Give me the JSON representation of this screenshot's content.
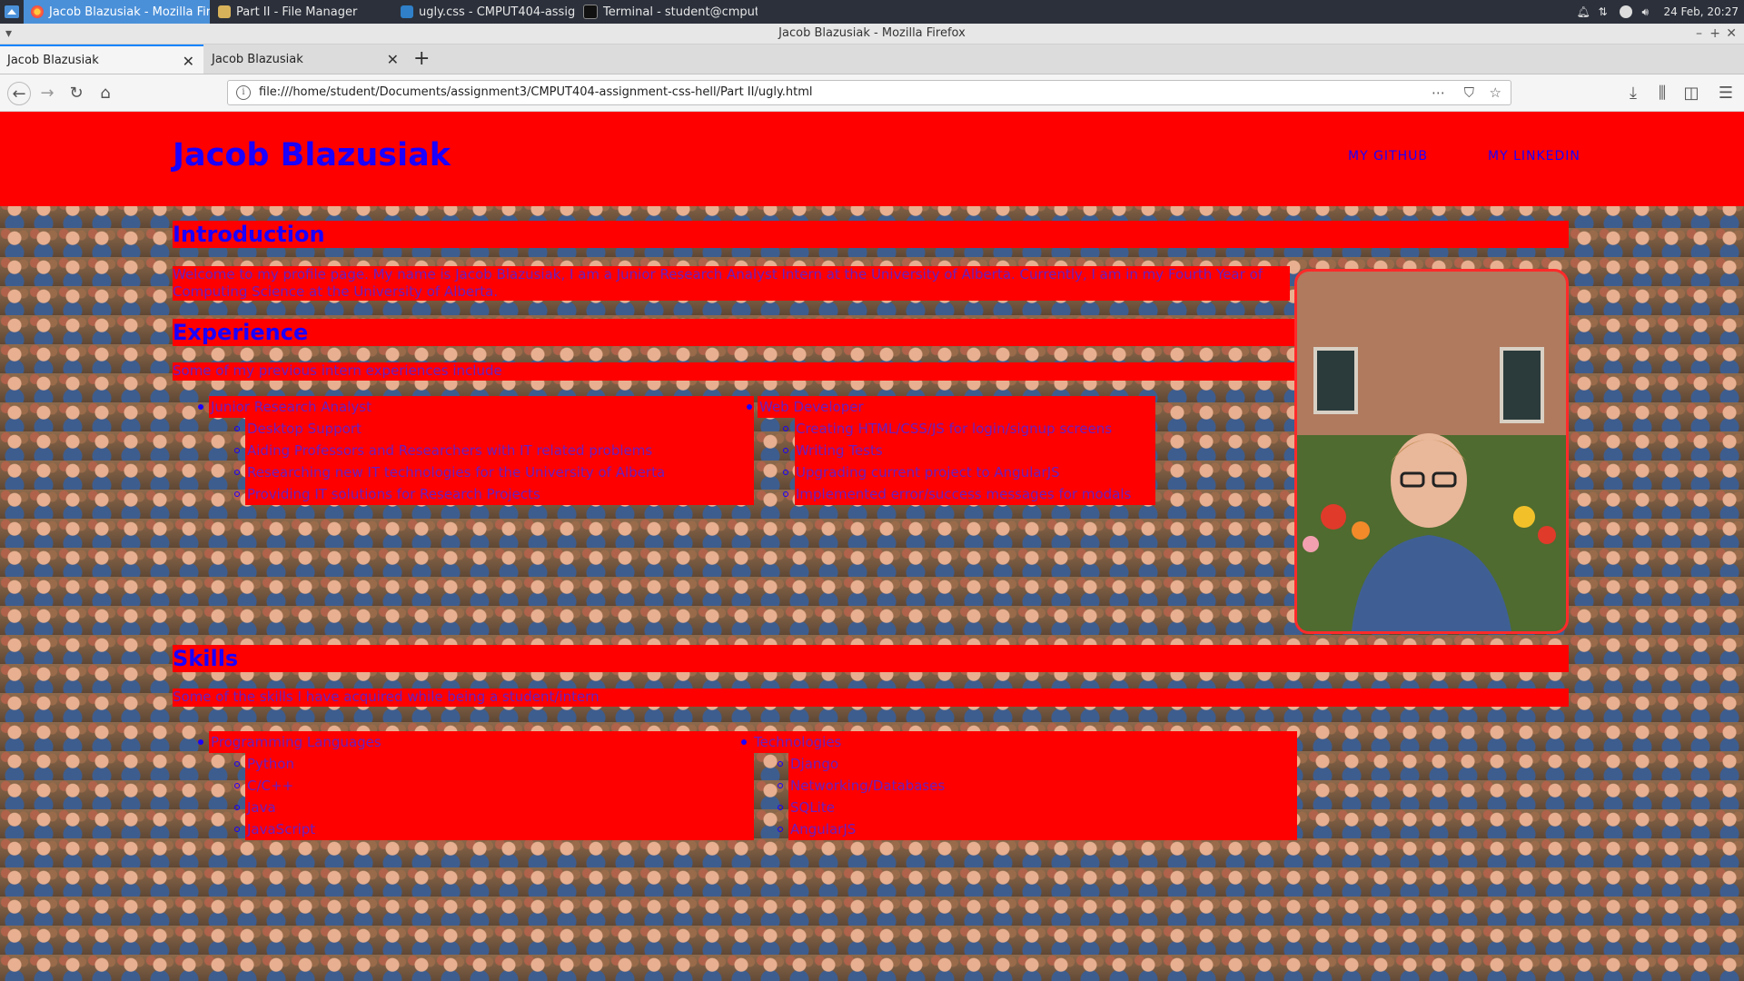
{
  "taskbar": {
    "tasks": [
      {
        "label": "Jacob Blazusiak - Mozilla Fire...",
        "active": true
      },
      {
        "label": "Part II - File Manager",
        "active": false
      },
      {
        "label": "ugly.css - CMPUT404-assign...",
        "active": false
      },
      {
        "label": "Terminal - student@cmput40...",
        "active": false
      }
    ],
    "clock": "24 Feb, 20:27"
  },
  "browser": {
    "window_title": "Jacob Blazusiak - Mozilla Firefox",
    "tabs": [
      {
        "label": "Jacob Blazusiak",
        "selected": true
      },
      {
        "label": "Jacob Blazusiak",
        "selected": false
      }
    ],
    "url": "file:///home/student/Documents/assignment3/CMPUT404-assignment-css-hell/Part II/ugly.html"
  },
  "page": {
    "site_title": "Jacob Blazusiak",
    "nav": {
      "github": "MY GITHUB",
      "linkedin": "MY LINKEDIN"
    },
    "intro": {
      "heading": "Introduction",
      "text": "Welcome to my profile page. My name is Jacob Blazusiak, I am a Junior Research Analyst Intern at the University of Alberta. Currently, I am in my Fourth Year of Computing Science at the University of Alberta."
    },
    "experience": {
      "heading": "Experience",
      "text": "Some of my previous intern experiences include",
      "jobs": [
        {
          "title": "Junior Research Analyst",
          "items": [
            "Desktop Support",
            "Aiding Professors and Researchers with IT related problems",
            "Researching new IT technologies for the University of Alberta",
            "Providing IT solutions for Research Projects"
          ]
        },
        {
          "title": "Web Developer",
          "items": [
            "Creating HTML/CSS/JS for login/signup screens",
            "Writing Tests",
            "Upgrading current project to AngularJS",
            "Implemented error/success messages for modals"
          ]
        }
      ]
    },
    "skills": {
      "heading": "Skills",
      "text": "Some of the skills I have acquired while being a student/intern",
      "groups": [
        {
          "title": "Programming Languages",
          "items": [
            "Python",
            "C/C++",
            "Java",
            "JavaScript"
          ]
        },
        {
          "title": "Technologies",
          "items": [
            "Django",
            "Networking/Databases",
            "SQLite",
            "AngularJS"
          ]
        }
      ]
    }
  },
  "colors": {
    "page_red": "#ff0000",
    "heading_blue": "#1a00ff",
    "text_purple": "#6a1fbf",
    "accent_blue": "#0a84ff"
  }
}
